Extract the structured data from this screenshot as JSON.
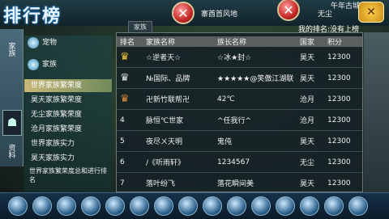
{
  "header": {
    "title": "排行榜",
    "center_text": "寨酋首风地",
    "right_text": "无尘",
    "server_text": "午年古城",
    "close_label": "✕"
  },
  "left_tabs": [
    "家族",
    "资料"
  ],
  "categories": {
    "items": [
      {
        "label": "宠物"
      },
      {
        "label": "家族"
      },
      {
        "label": "世界家族繁荣度"
      },
      {
        "label": "昊天家族繁荣度"
      },
      {
        "label": "无尘家族繁荣度"
      },
      {
        "label": "沧月家族繁荣度"
      },
      {
        "label": "世界家族实力"
      },
      {
        "label": "昊天家族实力"
      }
    ],
    "selected_index": 2,
    "footer": "世界家族繁荣度总和进行排名"
  },
  "panel": {
    "tab_label": "家族",
    "my_rank": "我的排名:没有上榜",
    "columns": [
      "排名",
      "家族名称",
      "族长名称",
      "国家",
      "积分"
    ],
    "rows": [
      {
        "rank": "",
        "crown": "gold",
        "family": "☆逆者天☆",
        "leader": "☆冰★封☆",
        "country": "昊天",
        "score": "12300"
      },
      {
        "rank": "",
        "crown": "silver",
        "family": "№国际、品牌",
        "leader": "★★★★★@笑傲江湖联",
        "country": "昊天",
        "score": "12300"
      },
      {
        "rank": "",
        "crown": "bronze",
        "family": "卍新竹联帮卍",
        "leader": "42℃",
        "country": "沧月",
        "score": "12300"
      },
      {
        "rank": "4",
        "crown": "",
        "family": "脉恒℃世家",
        "leader": "^任我行^",
        "country": "沧月",
        "score": "12300"
      },
      {
        "rank": "5",
        "crown": "",
        "family": "夜尽ㄨ天明",
        "leader": "鬼伅",
        "country": "昊天",
        "score": "12300"
      },
      {
        "rank": "6",
        "crown": "",
        "family": "/《听雨轩》",
        "leader": "1234567",
        "country": "无尘",
        "score": "12300"
      },
      {
        "rank": "7",
        "crown": "",
        "family": "落叶纷飞",
        "leader": "落花瞬间美",
        "country": "昊天",
        "score": "12300"
      }
    ]
  }
}
